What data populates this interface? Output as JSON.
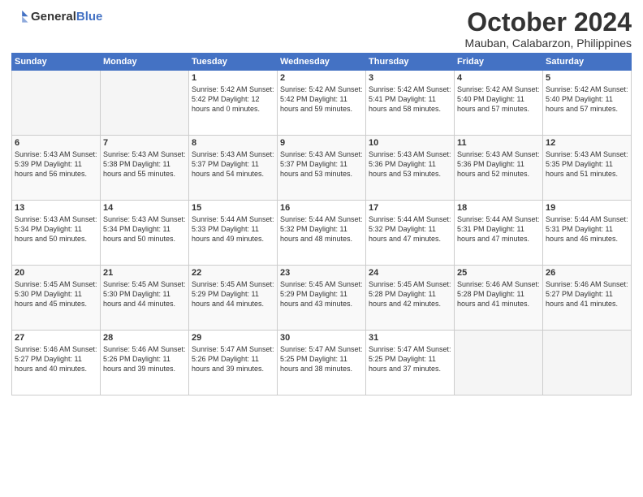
{
  "header": {
    "logo_general": "General",
    "logo_blue": "Blue",
    "month_title": "October 2024",
    "location": "Mauban, Calabarzon, Philippines"
  },
  "calendar": {
    "days_of_week": [
      "Sunday",
      "Monday",
      "Tuesday",
      "Wednesday",
      "Thursday",
      "Friday",
      "Saturday"
    ],
    "weeks": [
      [
        {
          "day": "",
          "info": ""
        },
        {
          "day": "",
          "info": ""
        },
        {
          "day": "1",
          "info": "Sunrise: 5:42 AM\nSunset: 5:42 PM\nDaylight: 12 hours\nand 0 minutes."
        },
        {
          "day": "2",
          "info": "Sunrise: 5:42 AM\nSunset: 5:42 PM\nDaylight: 11 hours\nand 59 minutes."
        },
        {
          "day": "3",
          "info": "Sunrise: 5:42 AM\nSunset: 5:41 PM\nDaylight: 11 hours\nand 58 minutes."
        },
        {
          "day": "4",
          "info": "Sunrise: 5:42 AM\nSunset: 5:40 PM\nDaylight: 11 hours\nand 57 minutes."
        },
        {
          "day": "5",
          "info": "Sunrise: 5:42 AM\nSunset: 5:40 PM\nDaylight: 11 hours\nand 57 minutes."
        }
      ],
      [
        {
          "day": "6",
          "info": "Sunrise: 5:43 AM\nSunset: 5:39 PM\nDaylight: 11 hours\nand 56 minutes."
        },
        {
          "day": "7",
          "info": "Sunrise: 5:43 AM\nSunset: 5:38 PM\nDaylight: 11 hours\nand 55 minutes."
        },
        {
          "day": "8",
          "info": "Sunrise: 5:43 AM\nSunset: 5:37 PM\nDaylight: 11 hours\nand 54 minutes."
        },
        {
          "day": "9",
          "info": "Sunrise: 5:43 AM\nSunset: 5:37 PM\nDaylight: 11 hours\nand 53 minutes."
        },
        {
          "day": "10",
          "info": "Sunrise: 5:43 AM\nSunset: 5:36 PM\nDaylight: 11 hours\nand 53 minutes."
        },
        {
          "day": "11",
          "info": "Sunrise: 5:43 AM\nSunset: 5:36 PM\nDaylight: 11 hours\nand 52 minutes."
        },
        {
          "day": "12",
          "info": "Sunrise: 5:43 AM\nSunset: 5:35 PM\nDaylight: 11 hours\nand 51 minutes."
        }
      ],
      [
        {
          "day": "13",
          "info": "Sunrise: 5:43 AM\nSunset: 5:34 PM\nDaylight: 11 hours\nand 50 minutes."
        },
        {
          "day": "14",
          "info": "Sunrise: 5:43 AM\nSunset: 5:34 PM\nDaylight: 11 hours\nand 50 minutes."
        },
        {
          "day": "15",
          "info": "Sunrise: 5:44 AM\nSunset: 5:33 PM\nDaylight: 11 hours\nand 49 minutes."
        },
        {
          "day": "16",
          "info": "Sunrise: 5:44 AM\nSunset: 5:32 PM\nDaylight: 11 hours\nand 48 minutes."
        },
        {
          "day": "17",
          "info": "Sunrise: 5:44 AM\nSunset: 5:32 PM\nDaylight: 11 hours\nand 47 minutes."
        },
        {
          "day": "18",
          "info": "Sunrise: 5:44 AM\nSunset: 5:31 PM\nDaylight: 11 hours\nand 47 minutes."
        },
        {
          "day": "19",
          "info": "Sunrise: 5:44 AM\nSunset: 5:31 PM\nDaylight: 11 hours\nand 46 minutes."
        }
      ],
      [
        {
          "day": "20",
          "info": "Sunrise: 5:45 AM\nSunset: 5:30 PM\nDaylight: 11 hours\nand 45 minutes."
        },
        {
          "day": "21",
          "info": "Sunrise: 5:45 AM\nSunset: 5:30 PM\nDaylight: 11 hours\nand 44 minutes."
        },
        {
          "day": "22",
          "info": "Sunrise: 5:45 AM\nSunset: 5:29 PM\nDaylight: 11 hours\nand 44 minutes."
        },
        {
          "day": "23",
          "info": "Sunrise: 5:45 AM\nSunset: 5:29 PM\nDaylight: 11 hours\nand 43 minutes."
        },
        {
          "day": "24",
          "info": "Sunrise: 5:45 AM\nSunset: 5:28 PM\nDaylight: 11 hours\nand 42 minutes."
        },
        {
          "day": "25",
          "info": "Sunrise: 5:46 AM\nSunset: 5:28 PM\nDaylight: 11 hours\nand 41 minutes."
        },
        {
          "day": "26",
          "info": "Sunrise: 5:46 AM\nSunset: 5:27 PM\nDaylight: 11 hours\nand 41 minutes."
        }
      ],
      [
        {
          "day": "27",
          "info": "Sunrise: 5:46 AM\nSunset: 5:27 PM\nDaylight: 11 hours\nand 40 minutes."
        },
        {
          "day": "28",
          "info": "Sunrise: 5:46 AM\nSunset: 5:26 PM\nDaylight: 11 hours\nand 39 minutes."
        },
        {
          "day": "29",
          "info": "Sunrise: 5:47 AM\nSunset: 5:26 PM\nDaylight: 11 hours\nand 39 minutes."
        },
        {
          "day": "30",
          "info": "Sunrise: 5:47 AM\nSunset: 5:25 PM\nDaylight: 11 hours\nand 38 minutes."
        },
        {
          "day": "31",
          "info": "Sunrise: 5:47 AM\nSunset: 5:25 PM\nDaylight: 11 hours\nand 37 minutes."
        },
        {
          "day": "",
          "info": ""
        },
        {
          "day": "",
          "info": ""
        }
      ]
    ]
  }
}
